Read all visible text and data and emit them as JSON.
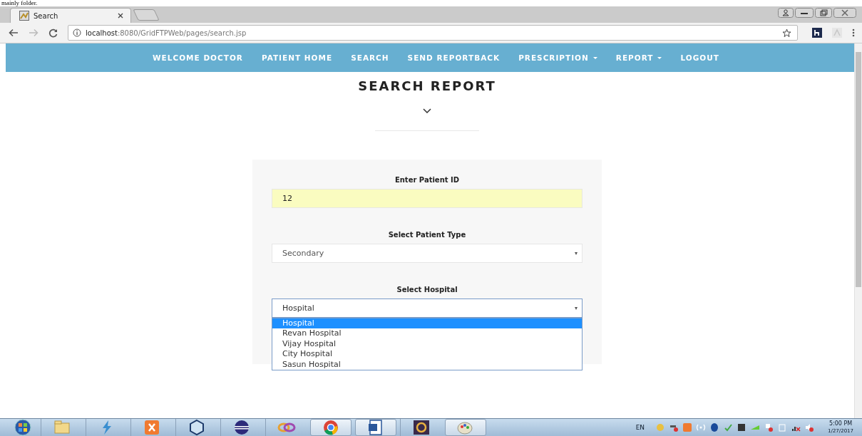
{
  "document_fragment": "mainly folder.",
  "browser": {
    "tabs": [
      {
        "title": "Search",
        "selected": true
      }
    ],
    "address": {
      "host": "localhost",
      "path": ":8080/GridFTPWeb/pages/search.jsp"
    }
  },
  "nav": {
    "items": [
      {
        "label": "WELCOME DOCTOR",
        "dropdown": false
      },
      {
        "label": "PATIENT HOME",
        "dropdown": false
      },
      {
        "label": "SEARCH",
        "dropdown": false
      },
      {
        "label": "SEND REPORTBACK",
        "dropdown": false
      },
      {
        "label": "PRESCRIPTION",
        "dropdown": true
      },
      {
        "label": "REPORT",
        "dropdown": true
      },
      {
        "label": "LOGOUT",
        "dropdown": false
      }
    ]
  },
  "page": {
    "title": "SEARCH REPORT"
  },
  "form": {
    "fields": [
      {
        "kind": "input",
        "label": "Enter Patient ID",
        "value": "12"
      },
      {
        "kind": "select",
        "label": "Select Patient Type",
        "value": "Secondary",
        "open": false
      },
      {
        "kind": "select",
        "label": "Select Hospital",
        "value": "Hospital",
        "open": true,
        "options": [
          {
            "label": "Hospital",
            "selected": true
          },
          {
            "label": "Revan Hospital",
            "selected": false
          },
          {
            "label": "Vijay Hospital",
            "selected": false
          },
          {
            "label": "City Hospital",
            "selected": false
          },
          {
            "label": "Sasun Hospital",
            "selected": false
          }
        ]
      }
    ]
  },
  "taskbar": {
    "language": "EN",
    "time": "5:00 PM",
    "date": "1/27/2017"
  }
}
